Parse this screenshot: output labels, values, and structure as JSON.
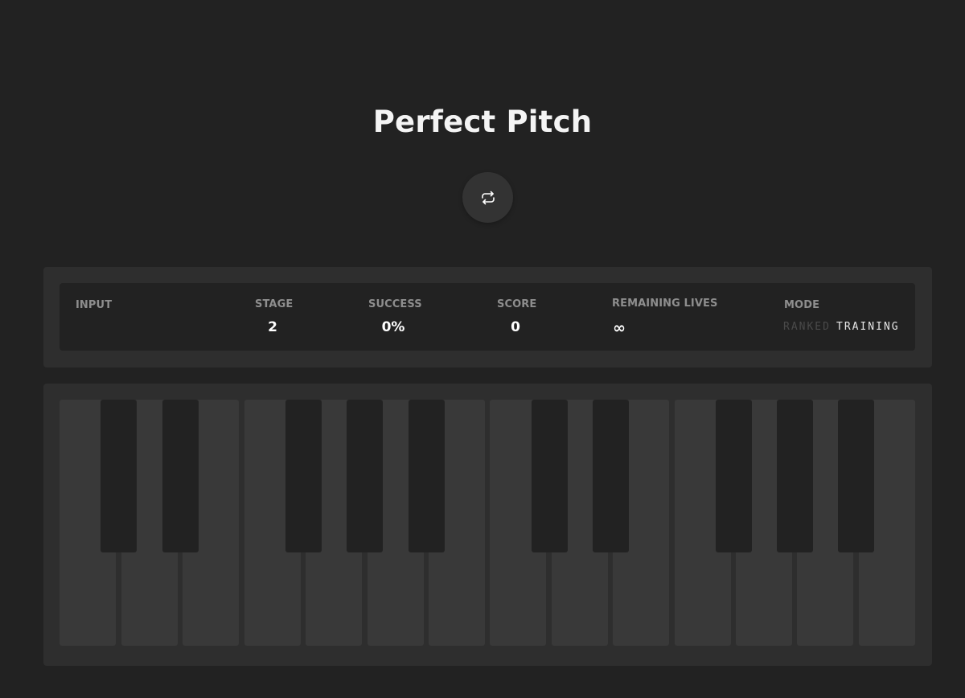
{
  "app": {
    "title": "Perfect Pitch"
  },
  "icons": {
    "logo": "sound-wave-icon",
    "replay": "repeat-icon"
  },
  "colors": {
    "background": "#222222",
    "panel": "#2e2e2e",
    "white_key": "#393939",
    "black_key": "#222222",
    "logo_gradient": [
      "#3fc38a",
      "#2aa8d6"
    ]
  },
  "stats": {
    "input": {
      "label": "INPUT",
      "value": ""
    },
    "stage": {
      "label": "STAGE",
      "value": "2"
    },
    "success": {
      "label": "SUCCESS",
      "value": "0%"
    },
    "score": {
      "label": "SCORE",
      "value": "0"
    },
    "lives": {
      "label": "REMAINING LIVES",
      "value": "∞"
    },
    "mode": {
      "label": "MODE",
      "options": [
        "RANKED",
        "TRAINING"
      ],
      "selected": "TRAINING"
    }
  },
  "keyboard": {
    "white_key_count": 14,
    "black_key_count": 10
  }
}
